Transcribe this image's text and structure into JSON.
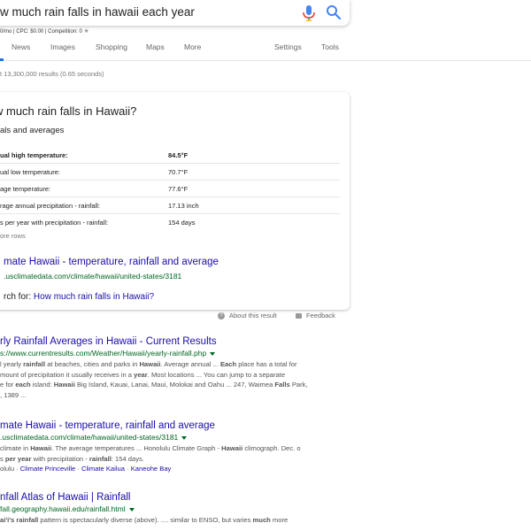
{
  "search": {
    "query": "w much rain falls in hawaii each year"
  },
  "seo_bar": {
    "text": "0/mo | CPC: $0.00 | Competition: 0",
    "star": "★"
  },
  "tabs": [
    {
      "label": "News"
    },
    {
      "label": "Images"
    },
    {
      "label": "Shopping"
    },
    {
      "label": "Maps"
    },
    {
      "label": "More"
    },
    {
      "label": "Settings"
    },
    {
      "label": "Tools"
    }
  ],
  "results_count": "t 13,300,000 results (0.65 seconds)",
  "snippet": {
    "title": "w much rain falls in Hawaii?",
    "subtitle": "als and averages",
    "rows": [
      {
        "label": "ual high temperature:",
        "value": "84.5°F"
      },
      {
        "label": "ual low temperature:",
        "value": "70.7°F"
      },
      {
        "label": "age temperature:",
        "value": "77.6°F"
      },
      {
        "label": "rage annual precipitation - rainfall:",
        "value": "17.13 inch"
      },
      {
        "label": "s per year with precipitation - rainfall:",
        "value": "154 days"
      }
    ],
    "more_rows": "ore rows",
    "link_title": "mate Hawaii - temperature, rainfall and average",
    "link_url": ".usclimatedata.com/climate/hawaii/united-states/3181",
    "search_for_prefix": "rch for: ",
    "search_for_link": "How much rain falls in Hawaii?",
    "about": "About this result",
    "feedback": "Feedback"
  },
  "results": [
    {
      "title": "rly Rainfall Averages in Hawaii - Current Results",
      "url": "s://www.currentresults.com/Weather/Hawaii/yearly-rainfall.php",
      "snippet_lines": [
        "l yearly rainfall at beaches, cities and parks in Hawaii. Average annual ... Each place has a total for",
        "mount of precipitation it usually receives in a year. Most locations ... You can jump to a separate",
        "e for each island: Hawaii Big Island, Kauai, Lanai, Maui, Molokai and Oahu ... 247, Waimea Falls Park,",
        ", 1389 ..."
      ]
    },
    {
      "title": "mate Hawaii - temperature, rainfall and average",
      "url": ".usclimatedata.com/climate/hawaii/united-states/3181",
      "snippet_lines": [
        "climate in Hawaii. The average temperatures ... Honolulu Climate Graph - Hawaii climograph. Dec. o",
        "s per year with precipitation - rainfall: 154 days."
      ],
      "sublinks_prefix": "olulu · ",
      "sublinks": [
        "Climate Princeville",
        "Climate Kailua",
        "Kaneohe Bay"
      ]
    },
    {
      "title": "nfall Atlas of Hawaii | Rainfall",
      "url": "fall.geography.hawaii.edu/rainfall.html",
      "snippet_lines": [
        "ai'i's rainfall pattern is spectacularly diverse (above). .... similar to ENSO, but varies much more"
      ]
    }
  ],
  "colors": {
    "link": "#1a0dab",
    "url": "#006621",
    "snippet": "#545454",
    "accent": "#1a73e8"
  },
  "icons": {
    "mic": "microphone-icon",
    "search": "search-icon",
    "about": "question-circle-icon",
    "feedback": "feedback-icon",
    "url_menu": "caret-down-icon"
  }
}
